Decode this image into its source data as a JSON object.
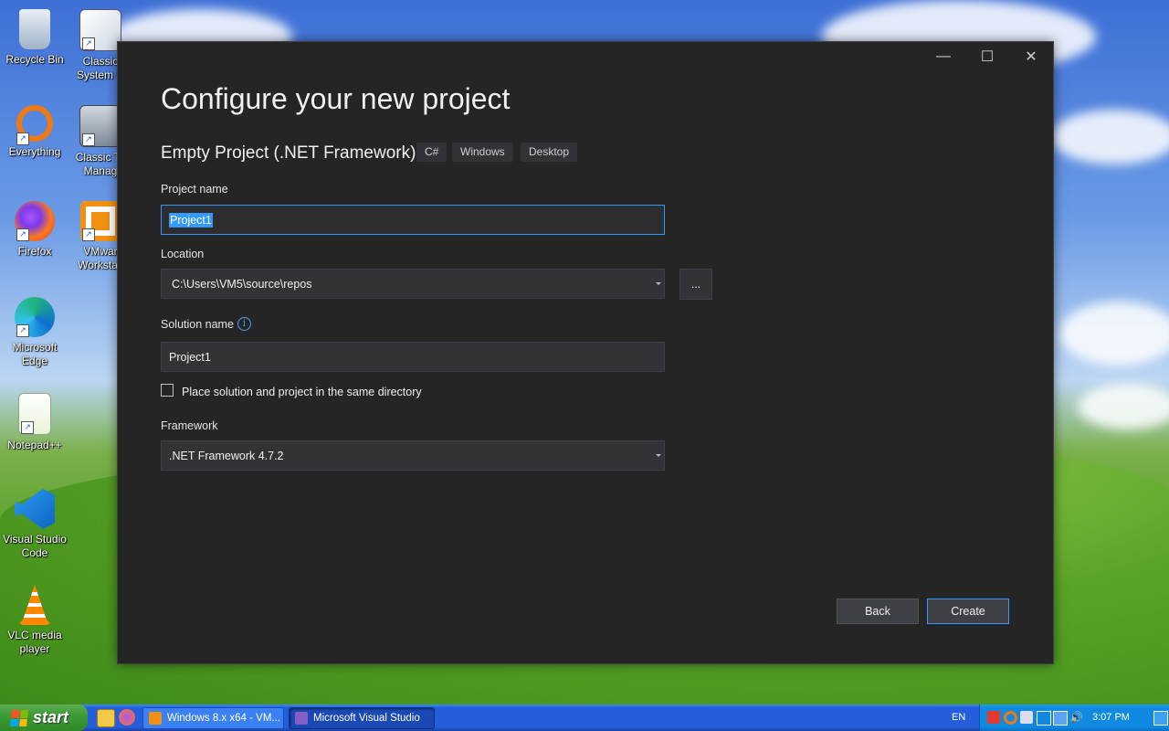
{
  "desktop": {
    "icons": [
      {
        "label": "Recycle Bin"
      },
      {
        "label": "Classic System C"
      },
      {
        "label": "Everything"
      },
      {
        "label": "Classic Ta Manag"
      },
      {
        "label": "Firefox"
      },
      {
        "label": "VMwar Workstati"
      },
      {
        "label": "Microsoft Edge"
      },
      {
        "label": "Notepad++"
      },
      {
        "label": "Visual Studio Code"
      },
      {
        "label": "VLC media player"
      }
    ]
  },
  "dialog": {
    "title": "Configure your new project",
    "template_name": "Empty Project (.NET Framework)",
    "tags": [
      "C#",
      "Windows",
      "Desktop"
    ],
    "project_name": {
      "label": "Project name",
      "value": "Project1"
    },
    "location": {
      "label": "Location",
      "value": "C:\\Users\\VM5\\source\\repos",
      "browse_label": "..."
    },
    "solution_name": {
      "label": "Solution name",
      "value": "Project1",
      "info_glyph": "i"
    },
    "same_directory": {
      "label": "Place solution and project in the same directory",
      "checked": false
    },
    "framework": {
      "label": "Framework",
      "value": ".NET Framework 4.7.2"
    },
    "back_label": "Back",
    "create_label": "Create",
    "window_controls": {
      "minimize": "—",
      "maximize": "☐",
      "close": "✕"
    }
  },
  "taskbar": {
    "start_label": "start",
    "tasks": [
      {
        "label": "Windows 8.x x64 - VM...",
        "active": false
      },
      {
        "label": "Microsoft Visual Studio",
        "active": true
      }
    ],
    "language": "EN",
    "clock": "3:07 PM"
  },
  "colors": {
    "dialog_bg": "#252526",
    "field_bg": "#333337",
    "accent": "#3399ff",
    "taskbar": "#245edb",
    "start_green": "#3c9b33"
  }
}
